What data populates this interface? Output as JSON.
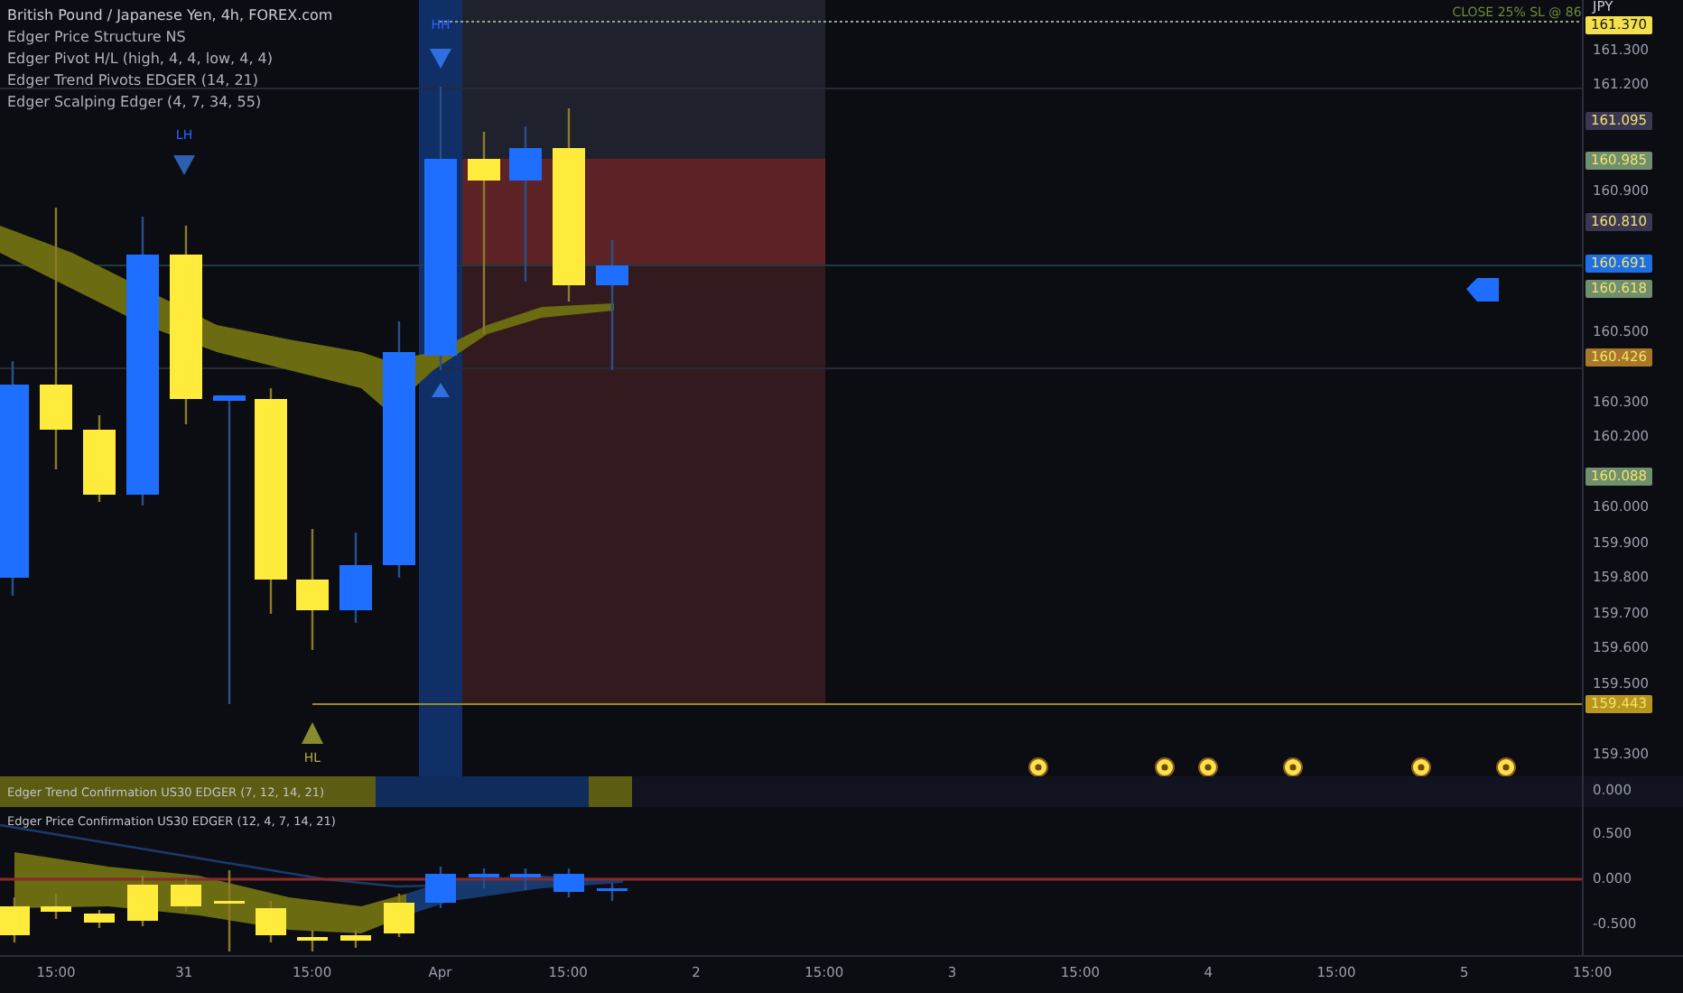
{
  "legend": [
    "British Pound / Japanese Yen, 4h, FOREX.com",
    "Edger Price Structure NS",
    "Edger Pivot H/L (high, 4, 4, low, 4, 4)",
    "Edger Trend Pivots EDGER (14, 21)",
    "Edger Scalping Edger (4, 7, 34, 55)"
  ],
  "main_chart": {
    "annotation": "CLOSE 25% SL @ 86",
    "pivots": [
      {
        "text": "LH"
      },
      {
        "text": "HH"
      },
      {
        "text": "HL"
      }
    ]
  },
  "price_axis": {
    "currency": "JPY",
    "ticks": [
      "161.300",
      "161.200",
      "160.900",
      "160.500",
      "160.300",
      "160.200",
      "160.000",
      "159.900",
      "159.800",
      "159.700",
      "159.600",
      "159.500",
      "159.300"
    ],
    "labels": [
      {
        "text": "161.370",
        "color": "#f4e04d"
      },
      {
        "text": "161.095",
        "color": "#3b3752"
      },
      {
        "text": "160.985",
        "color": "#6f8f6f"
      },
      {
        "text": "160.810",
        "color": "#3b3752"
      },
      {
        "text": "160.691",
        "color": "#1e6fe6"
      },
      {
        "text": "160.618",
        "color": "#6f8f6f"
      },
      {
        "text": "160.426",
        "color": "#a8772a"
      },
      {
        "text": "160.088",
        "color": "#6f8f6f"
      },
      {
        "text": "159.443",
        "color": "#b8961e"
      }
    ]
  },
  "trend_pane": {
    "title": "Edger Trend Confirmation US30 EDGER (7, 12, 14, 21)",
    "axis_value": "0.000"
  },
  "price_confirmation": {
    "title": "Edger Price Confirmation US30 EDGER (12, 4, 7, 14, 21)",
    "ticks": [
      "0.500",
      "0.000",
      "-0.500"
    ]
  },
  "time_axis": [
    "15:00",
    "31",
    "15:00",
    "Apr",
    "15:00",
    "2",
    "15:00",
    "3",
    "15:00",
    "4",
    "15:00",
    "5",
    "15:00"
  ]
}
